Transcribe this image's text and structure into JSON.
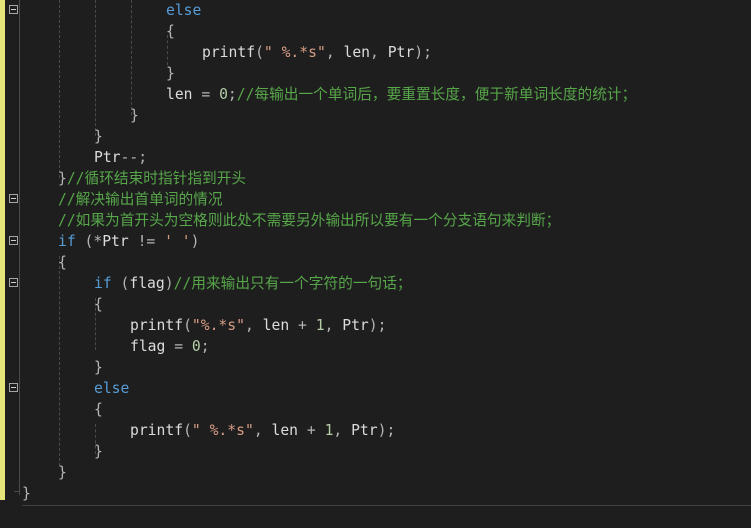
{
  "colors": {
    "background": "#1e1e1e",
    "keyword": "#569cd6",
    "string": "#d69d85",
    "comment": "#57a64a",
    "number": "#b5cea8",
    "identifier": "#dcdcdc",
    "change_bar": "#e5e57a"
  },
  "code": {
    "lines": [
      {
        "tokens": [
          {
            "t": "kw",
            "v": "else"
          }
        ]
      },
      {
        "tokens": [
          {
            "t": "op",
            "v": "{"
          }
        ]
      },
      {
        "tokens": [
          {
            "t": "id",
            "v": "printf"
          },
          {
            "t": "op",
            "v": "("
          },
          {
            "t": "str",
            "v": "\" %.*s\""
          },
          {
            "t": "op",
            "v": ", "
          },
          {
            "t": "id",
            "v": "len"
          },
          {
            "t": "op",
            "v": ", "
          },
          {
            "t": "id",
            "v": "Ptr"
          },
          {
            "t": "op",
            "v": ");"
          }
        ]
      },
      {
        "tokens": [
          {
            "t": "op",
            "v": "}"
          }
        ]
      },
      {
        "tokens": [
          {
            "t": "id",
            "v": "len"
          },
          {
            "t": "op",
            "v": " = "
          },
          {
            "t": "num",
            "v": "0"
          },
          {
            "t": "op",
            "v": ";"
          },
          {
            "t": "cmt",
            "v": "//每输出一个单词后，要重置长度，便于新单词长度的统计；"
          }
        ]
      },
      {
        "tokens": [
          {
            "t": "op",
            "v": "}"
          }
        ]
      },
      {
        "tokens": [
          {
            "t": "op",
            "v": "}"
          }
        ]
      },
      {
        "tokens": [
          {
            "t": "id",
            "v": "Ptr"
          },
          {
            "t": "op",
            "v": "--;"
          }
        ]
      },
      {
        "tokens": [
          {
            "t": "op",
            "v": "}"
          },
          {
            "t": "cmt",
            "v": "//循环结束时指针指到开头"
          }
        ]
      },
      {
        "tokens": [
          {
            "t": "cmt",
            "v": "//解决输出首单词的情况"
          }
        ]
      },
      {
        "tokens": [
          {
            "t": "cmt",
            "v": "//如果为首开头为空格则此处不需要另外输出所以要有一个分支语句来判断；"
          }
        ]
      },
      {
        "tokens": [
          {
            "t": "kw",
            "v": "if"
          },
          {
            "t": "op",
            "v": " (*"
          },
          {
            "t": "id",
            "v": "Ptr"
          },
          {
            "t": "op",
            "v": " != "
          },
          {
            "t": "str",
            "v": "' '"
          },
          {
            "t": "op",
            "v": ")"
          }
        ]
      },
      {
        "tokens": [
          {
            "t": "op",
            "v": "{"
          }
        ]
      },
      {
        "tokens": [
          {
            "t": "kw",
            "v": "if"
          },
          {
            "t": "op",
            "v": " ("
          },
          {
            "t": "id",
            "v": "flag"
          },
          {
            "t": "op",
            "v": ")"
          },
          {
            "t": "cmt",
            "v": "//用来输出只有一个字符的一句话；"
          }
        ]
      },
      {
        "tokens": [
          {
            "t": "op",
            "v": "{"
          }
        ]
      },
      {
        "tokens": [
          {
            "t": "id",
            "v": "printf"
          },
          {
            "t": "op",
            "v": "("
          },
          {
            "t": "str",
            "v": "\"%.*s\""
          },
          {
            "t": "op",
            "v": ", "
          },
          {
            "t": "id",
            "v": "len"
          },
          {
            "t": "op",
            "v": " + "
          },
          {
            "t": "num",
            "v": "1"
          },
          {
            "t": "op",
            "v": ", "
          },
          {
            "t": "id",
            "v": "Ptr"
          },
          {
            "t": "op",
            "v": ");"
          }
        ]
      },
      {
        "tokens": [
          {
            "t": "id",
            "v": "flag"
          },
          {
            "t": "op",
            "v": " = "
          },
          {
            "t": "num",
            "v": "0"
          },
          {
            "t": "op",
            "v": ";"
          }
        ]
      },
      {
        "tokens": [
          {
            "t": "op",
            "v": "}"
          }
        ]
      },
      {
        "tokens": [
          {
            "t": "kw",
            "v": "else"
          }
        ]
      },
      {
        "tokens": [
          {
            "t": "op",
            "v": "{"
          }
        ]
      },
      {
        "tokens": [
          {
            "t": "id",
            "v": "printf"
          },
          {
            "t": "op",
            "v": "("
          },
          {
            "t": "str",
            "v": "\" %.*s\""
          },
          {
            "t": "op",
            "v": ", "
          },
          {
            "t": "id",
            "v": "len"
          },
          {
            "t": "op",
            "v": " + "
          },
          {
            "t": "num",
            "v": "1"
          },
          {
            "t": "op",
            "v": ", "
          },
          {
            "t": "id",
            "v": "Ptr"
          },
          {
            "t": "op",
            "v": ");"
          }
        ]
      },
      {
        "tokens": [
          {
            "t": "op",
            "v": "}"
          }
        ]
      },
      {
        "tokens": [
          {
            "t": "op",
            "v": "}"
          }
        ]
      },
      {
        "tokens": [
          {
            "t": "op",
            "v": "}"
          }
        ]
      }
    ]
  },
  "fold_markers": [
    {
      "icon": "collapse-icon"
    },
    {
      "icon": "collapse-icon"
    },
    {
      "icon": "collapse-icon"
    },
    {
      "icon": "collapse-icon"
    },
    {
      "icon": "collapse-icon"
    }
  ]
}
